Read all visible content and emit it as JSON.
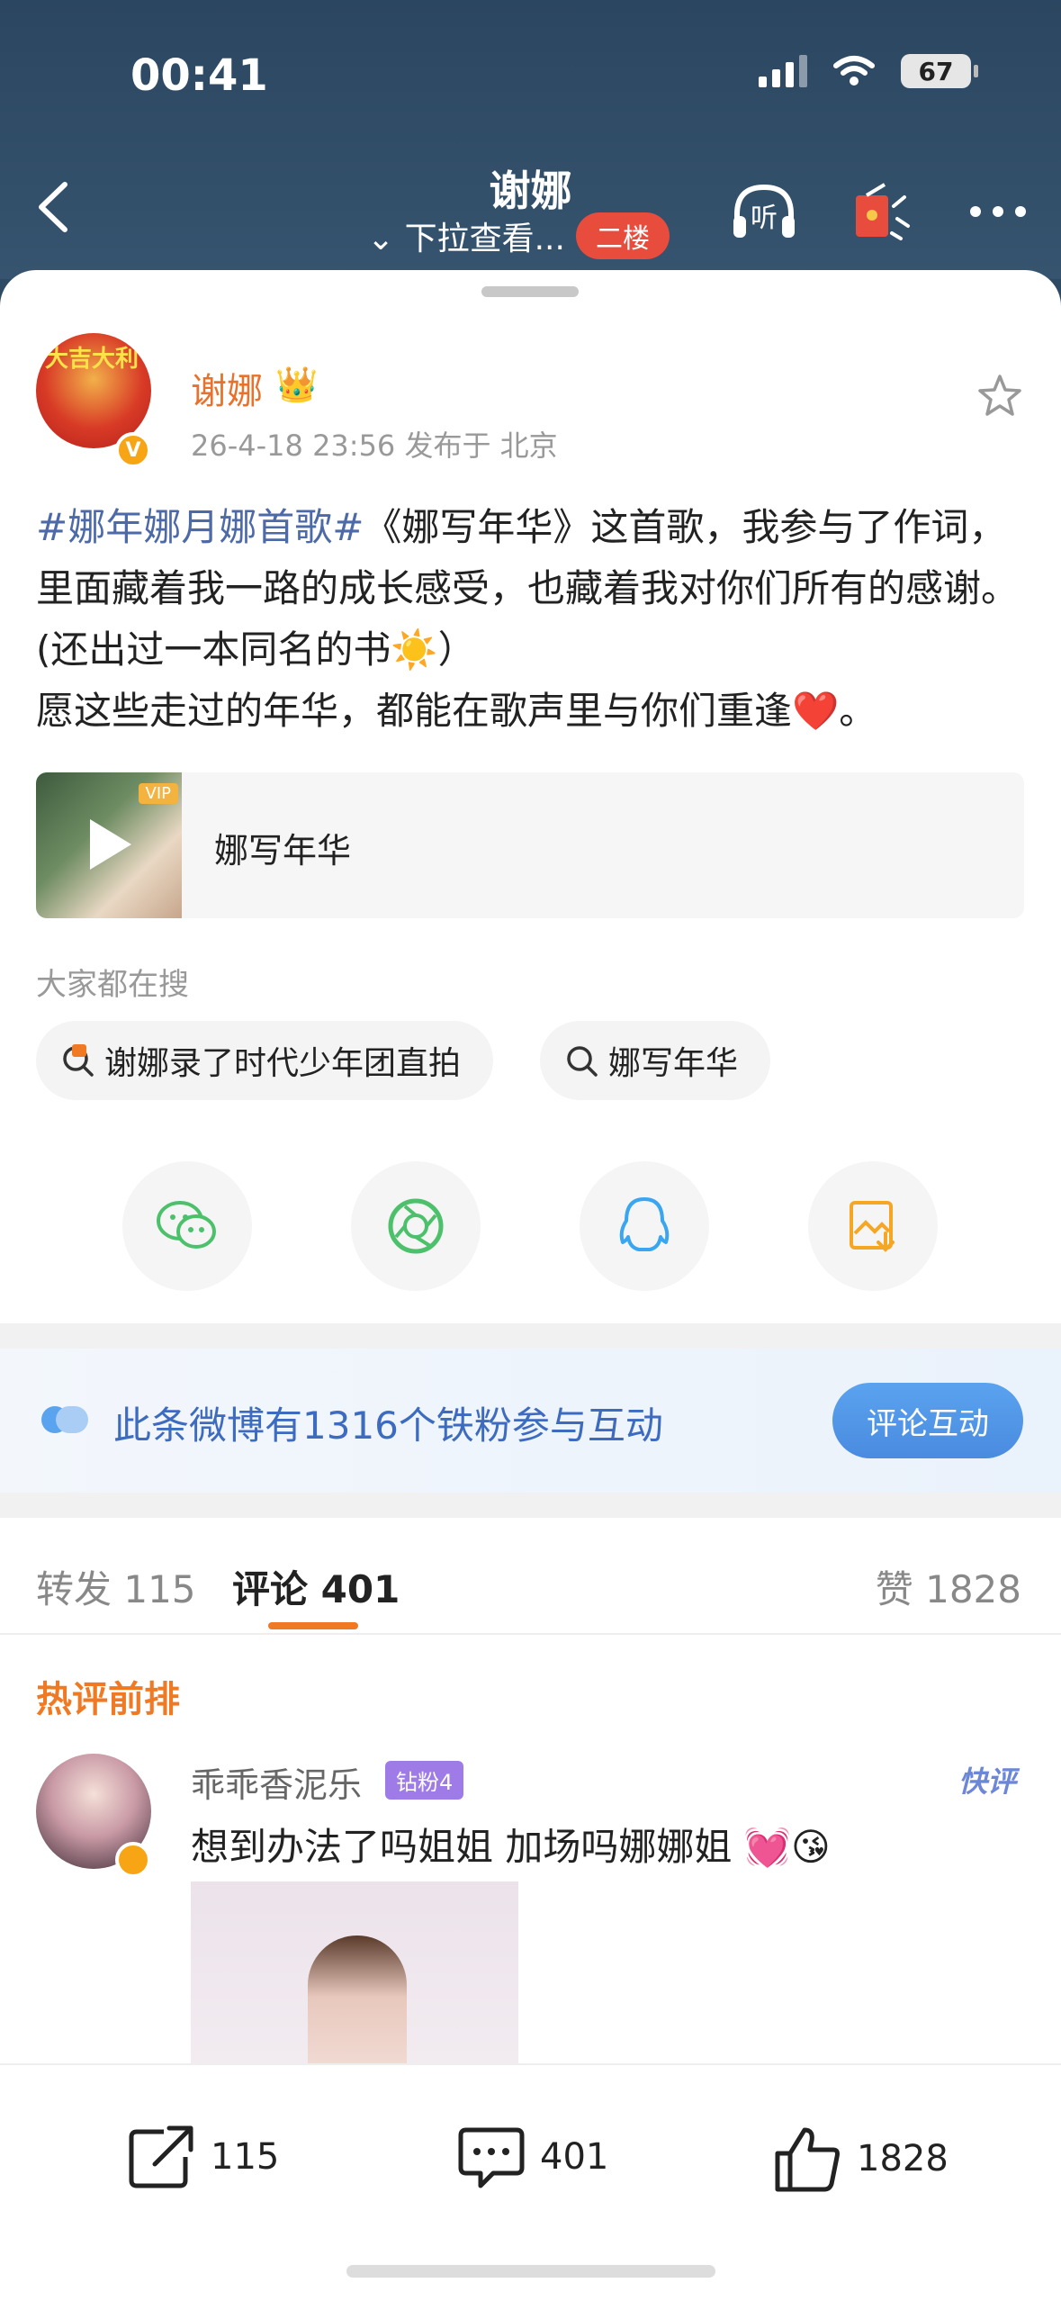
{
  "status": {
    "time": "00:41",
    "battery": "67"
  },
  "header": {
    "title": "谢娜",
    "subtitle": "⌄ 下拉查看...",
    "floor_badge": "二楼",
    "listen_label": "听"
  },
  "post": {
    "author": "谢娜",
    "avatar_text": "大吉大利",
    "meta": "26-4-18 23:56  发布于 北京",
    "hashtag": "#娜年娜月娜首歌#",
    "body_rest": "《娜写年华》这首歌，我参与了作词，里面藏着我一路的成长感受，也藏着我对你们所有的感谢。(还出过一本同名的书☀️）",
    "body_line2": "愿这些走过的年华，都能在歌声里与你们重逢❤️。",
    "music_title": "娜写年华",
    "music_vip": "VIP"
  },
  "search": {
    "label": "大家都在搜",
    "chips": [
      "谢娜录了时代少年团直拍",
      "娜写年华"
    ]
  },
  "share_icons": [
    "wechat-icon",
    "moments-icon",
    "qq-icon",
    "save-image-icon"
  ],
  "fans_banner": {
    "text": "此条微博有1316个铁粉参与互动",
    "button": "评论互动"
  },
  "tabs": {
    "repost": "转发 115",
    "comment": "评论 401",
    "like": "赞 1828"
  },
  "comments_section": {
    "hot_label": "热评前排",
    "items": [
      {
        "user": "乖乖香泥乐",
        "badge": "钻粉4",
        "tag": "快评",
        "text": "想到办法了吗姐姐 加场吗娜娜姐 💓😘"
      }
    ]
  },
  "bottom_bar": {
    "repost": "115",
    "comment": "401",
    "like": "1828"
  },
  "colors": {
    "header_bg": "#2f4a63",
    "accent_orange": "#f07a24",
    "link_blue": "#4d6aa8",
    "badge_red": "#e84c3d"
  }
}
